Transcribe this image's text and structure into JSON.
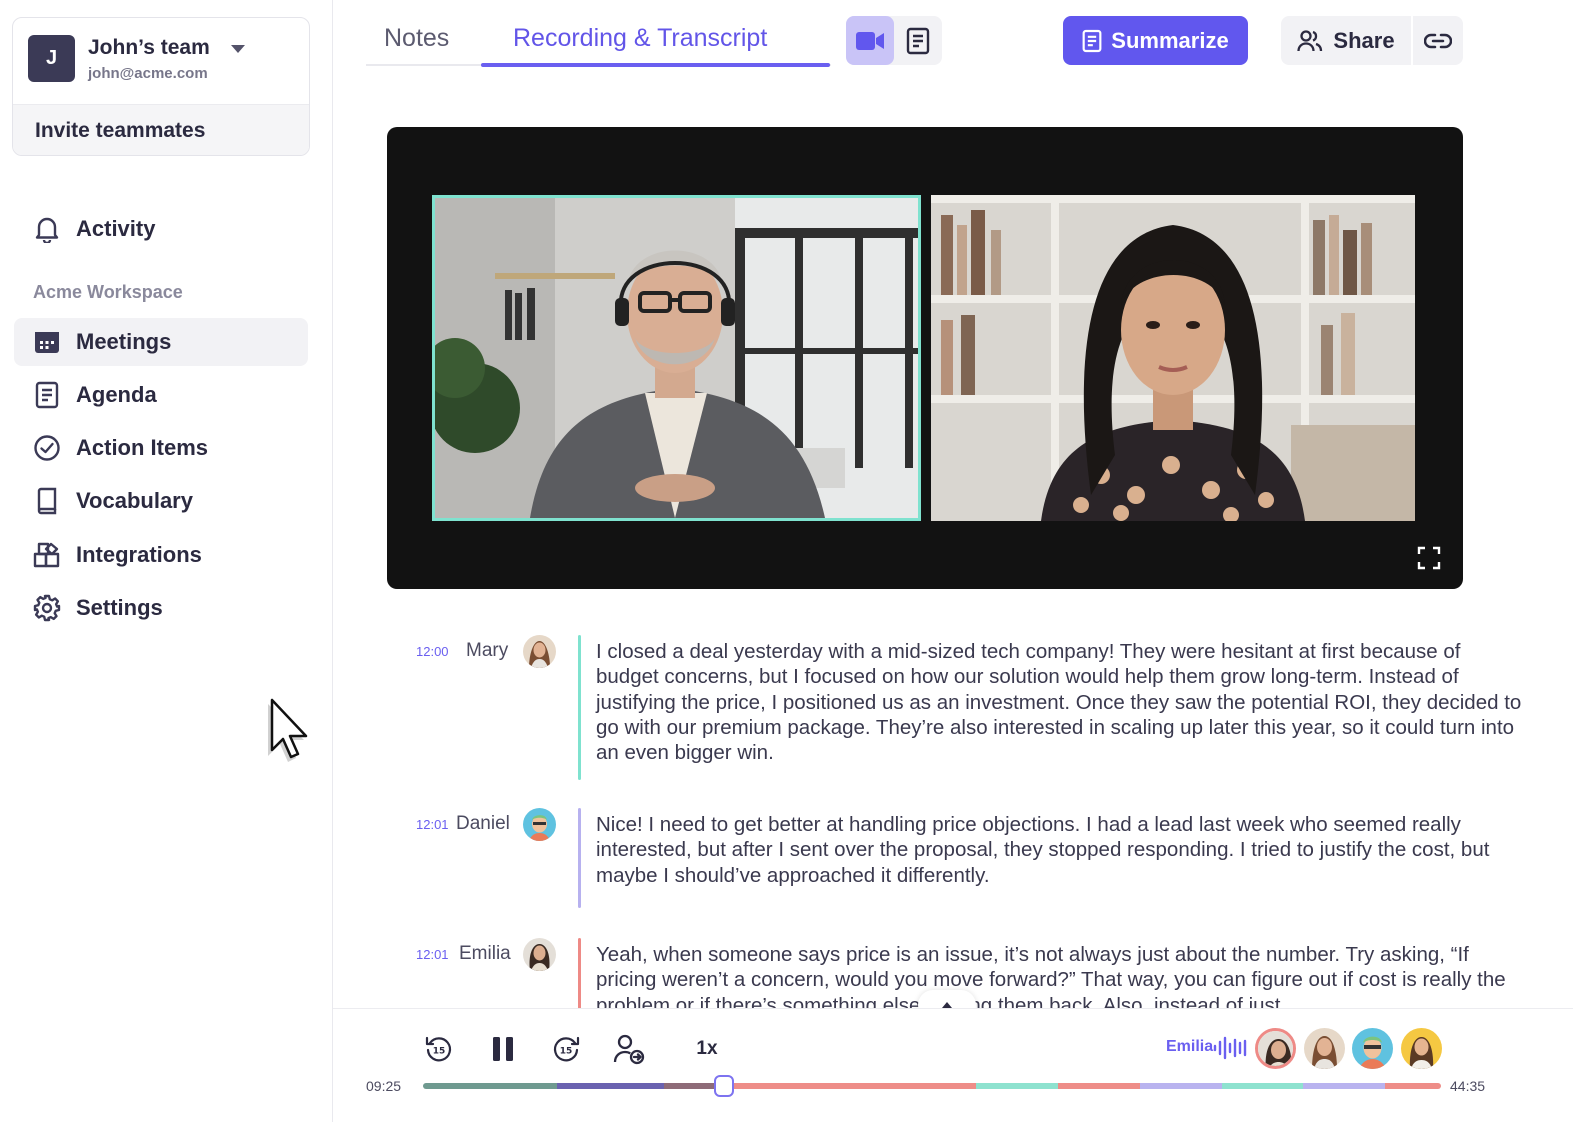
{
  "team": {
    "initial": "J",
    "name": "John’s team",
    "email": "john@acme.com",
    "invite_label": "Invite teammates"
  },
  "nav": {
    "activity": "Activity",
    "workspace_label": "Acme Workspace",
    "items": [
      {
        "label": "Meetings",
        "icon": "calendar-icon",
        "active": true
      },
      {
        "label": "Agenda",
        "icon": "document-icon"
      },
      {
        "label": "Action Items",
        "icon": "check-circle-icon"
      },
      {
        "label": "Vocabulary",
        "icon": "book-icon"
      },
      {
        "label": "Integrations",
        "icon": "puzzle-icon"
      },
      {
        "label": "Settings",
        "icon": "gear-icon"
      }
    ]
  },
  "header": {
    "tabs": [
      {
        "label": "Notes"
      },
      {
        "label": "Recording & Transcript",
        "active": true
      }
    ],
    "summarize_label": "Summarize",
    "share_label": "Share"
  },
  "transcript": [
    {
      "time": "12:00",
      "speaker": "Mary",
      "bar_color": "#7fe2cf",
      "text": "I closed a deal yesterday with a mid-sized tech company! They were hesitant at first because of budget concerns, but I focused on how our solution would help them grow long-term. Instead of justifying the price, I positioned us as an investment. Once they saw the potential ROI, they decided to go with our premium package. They’re also interested in scaling up later this year, so it could turn into an even bigger win."
    },
    {
      "time": "12:01",
      "speaker": "Daniel",
      "bar_color": "#b7b1ef",
      "text": "Nice! I need to get better at handling price objections. I had a lead last week who seemed really interested, but after I sent over the proposal, they stopped responding. I tried to justify the cost, but maybe I should’ve approached it differently."
    },
    {
      "time": "12:01",
      "speaker": "Emilia",
      "bar_color": "#ee8a86",
      "text": "Yeah, when someone says price is an issue, it’s not always just about the number. Try asking, “If pricing weren’t a concern, would you move forward?” That way, you can figure out if cost is really the problem or if there’s something else holding them back. Also, instead of just"
    }
  ],
  "player": {
    "speed": "1x",
    "speaking": "Emilia",
    "current_time": "09:25",
    "total_time": "44:35",
    "progress": 0.296,
    "colors": {
      "accent": "#6157ee",
      "mint": "#8ee2cf",
      "purple": "#b9b3ef",
      "coral": "#ee8d88"
    }
  }
}
